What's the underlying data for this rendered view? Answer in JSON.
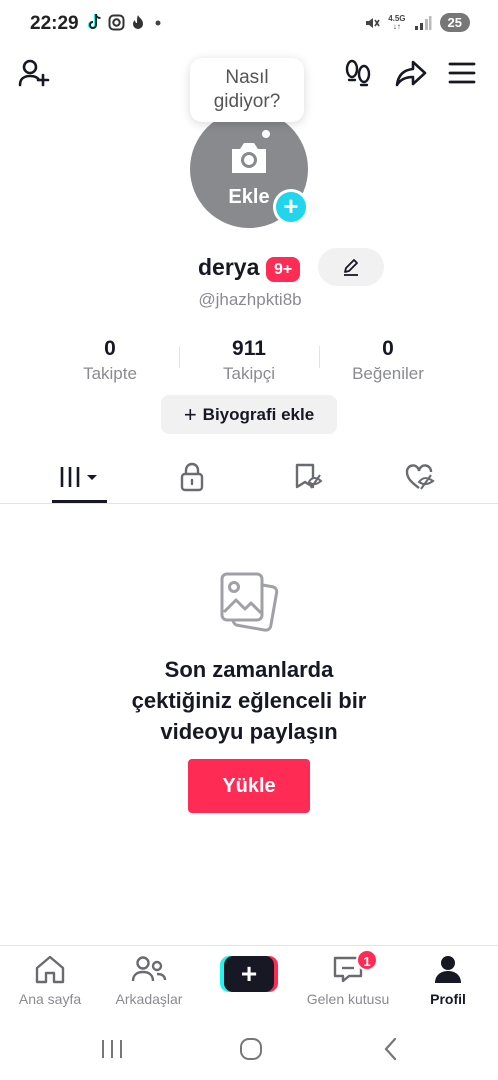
{
  "status_bar": {
    "time": "22:29",
    "network_top": "4.5G",
    "network_bottom": "↓↑",
    "battery": "25",
    "app_icons": [
      "tiktok-icon",
      "instagram-icon",
      "tinder-icon",
      "dot-icon"
    ],
    "right_icons": [
      "mute-icon",
      "signal-icon"
    ]
  },
  "header": {
    "icons": [
      "add-friend-icon",
      "footprints-icon",
      "share-icon",
      "menu-icon"
    ]
  },
  "tooltip": {
    "line1": "Nasıl",
    "line2": "gidiyor?"
  },
  "avatar": {
    "label": "Ekle",
    "add_symbol": "+"
  },
  "profile": {
    "username": "derya",
    "badge": "9+",
    "handle": "@jhazhpkti8b"
  },
  "stats": [
    {
      "value": "0",
      "label": "Takipte"
    },
    {
      "value": "911",
      "label": "Takipçi"
    },
    {
      "value": "0",
      "label": "Beğeniler"
    }
  ],
  "bio_button": {
    "symbol": "+",
    "label": "Biyografi ekle"
  },
  "tabs": [
    "videos-grid-icon",
    "lock-icon",
    "favorites-icon",
    "liked-icon"
  ],
  "empty_state": {
    "icon": "photos-icon",
    "line1": "Son zamanlarda",
    "line2": "çektiğiniz eğlenceli bir",
    "line3": "videoyu paylaşın",
    "button": "Yükle"
  },
  "bottom_nav": {
    "items": [
      {
        "label": "Ana sayfa",
        "icon": "home-icon"
      },
      {
        "label": "Arkadaşlar",
        "icon": "friends-icon"
      },
      {
        "label": "",
        "icon": "create-icon",
        "symbol": "+"
      },
      {
        "label": "Gelen kutusu",
        "icon": "inbox-icon",
        "badge": "1"
      },
      {
        "label": "Profil",
        "icon": "profile-icon"
      }
    ]
  },
  "colors": {
    "accent": "#fe2c55",
    "cyan": "#20d5ec",
    "text": "#161823",
    "muted": "#8a8b91"
  }
}
